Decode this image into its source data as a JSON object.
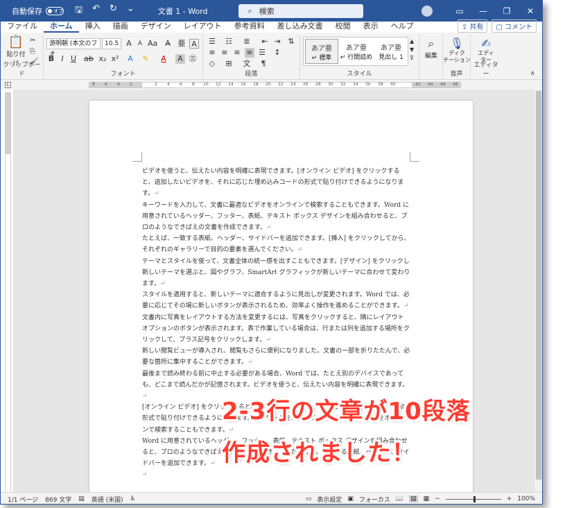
{
  "titlebar": {
    "autosave_label": "自動保存",
    "autosave_state": "オフ",
    "doc_title": "文書 1  -  Word",
    "search_placeholder": "検索",
    "min": "—",
    "restore": "❐",
    "close": "✕",
    "ribbon_display": "▭"
  },
  "tabs": [
    "ファイル",
    "ホーム",
    "挿入",
    "描画",
    "デザイン",
    "レイアウト",
    "参考資料",
    "差し込み文書",
    "校閲",
    "表示",
    "ヘルプ"
  ],
  "active_tab": "ホーム",
  "share_label": "共有",
  "comment_label": "コメント",
  "ribbon": {
    "clipboard": {
      "paste_label": "貼り付け",
      "group": "クリップボード"
    },
    "font": {
      "name": "游明朝 (本文のフォ",
      "size": "10.5",
      "group": "フォント"
    },
    "paragraph": {
      "group": "段落"
    },
    "styles": {
      "group": "スタイル",
      "items": [
        {
          "sample": "あア亜",
          "label": "↵ 標準"
        },
        {
          "sample": "あア亜",
          "label": "↵ 行間詰め"
        },
        {
          "sample": "あア亜",
          "label": "見出し 1"
        }
      ]
    },
    "editing": {
      "label": "編集"
    },
    "voice": {
      "label": "ディク\nテーション",
      "group": "音声"
    },
    "editor": {
      "label": "エディ\nター",
      "group": "エディター"
    }
  },
  "ruler": {
    "left_ticks": [
      "8",
      "6",
      "4",
      "2"
    ],
    "ticks": [
      "2",
      "4",
      "6",
      "8",
      "10",
      "12",
      "14",
      "16",
      "18",
      "20",
      "22",
      "24",
      "26",
      "28",
      "30",
      "32",
      "34",
      "36",
      "38",
      "40"
    ],
    "right_ticks": [
      "42",
      "44",
      "46",
      "48"
    ]
  },
  "document": {
    "paragraphs": [
      "ビデオを使うと、伝えたい内容を明確に表現できます。[オンライン ビデオ] をクリックすると、追加したいビデオを、それに応じた埋め込みコードの形式で貼り付けできるようになります。",
      "キーワードを入力して、文書に最適なビデオをオンラインで検索することもできます。Word に用意されているヘッダー、フッター、表紙、テキスト ボックス デザインを組み合わせると、プロのようなできばえの文書を作成できます。",
      "たとえば、一致する表紙、ヘッダー、サイドバーを追加できます。[挿入] をクリックしてから、それぞれのギャラリーで目的の要素を選んでください。",
      "テーマとスタイルを使って、文書全体の統一感を出すこともできます。[デザイン] をクリックし新しいテーマを選ぶと、図やグラフ、SmartArt グラフィックが新しいテーマに合わせて変わります。",
      "スタイルを適用すると、新しいテーマに適合するように見出しが変更されます。Word では、必要に応じてその場に新しいボタンが表示されるため、効率よく操作を進めることができます。",
      "文書内に写真をレイアウトする方法を変更するには、写真をクリックすると、隣にレイアウト オプションのボタンが表示されます。表で作業している場合は、行または列を追加する場所をクリックして、プラス記号をクリックします。",
      "新しい閲覧ビューが導入され、閲覧もさらに便利になりました。文書の一部を折りたたんで、必要な箇所に集中することができます。",
      "最後まで読み終わる前に中止する必要がある場合、Word では、たとえ別のデバイスであっても、どこまで読んだかが記憶されます。ビデオを使うと、伝えたい内容を明確に表現できます。",
      "[オンライン ビデオ] をクリックすると、追加したいビデオを、それに応じた埋め込みコードの形式で貼り付けできるようになります。キーワードを入力して、文書に最適なビデオをオンラインで検索することもできます。",
      "Word に用意されているヘッダー、フッター、表紙、テキスト ボックス デザインを組み合わせると、プロのようなできばえの文書を作成できます。たとえば、一致する表紙、ヘッダー、サイドバーを追加できます。"
    ],
    "para_mark": "↵"
  },
  "statusbar": {
    "page": "1/1 ページ",
    "words": "869 文字",
    "language": "英語 (米国)",
    "display_settings": "表示設定",
    "focus": "フォーカス",
    "zoom": "100%",
    "zoom_level": 0.5
  },
  "overlay": {
    "line1": "2-3行の文章が10段落",
    "line2": "作成されました！"
  }
}
